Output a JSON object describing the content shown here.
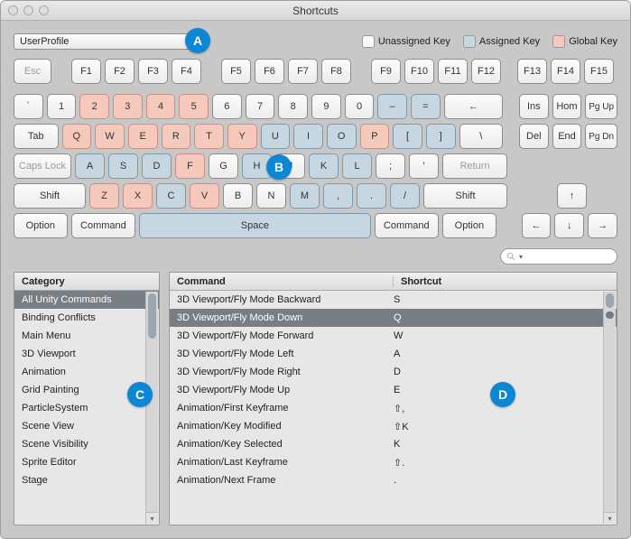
{
  "window": {
    "title": "Shortcuts"
  },
  "profile": {
    "label": "UserProfile"
  },
  "legend": {
    "unassigned": "Unassigned Key",
    "assigned": "Assigned Key",
    "global": "Global Key"
  },
  "badges": {
    "a": "A",
    "b": "B",
    "c": "C",
    "d": "D"
  },
  "keys": {
    "esc": "Esc",
    "f1": "F1",
    "f2": "F2",
    "f3": "F3",
    "f4": "F4",
    "f5": "F5",
    "f6": "F6",
    "f7": "F7",
    "f8": "F8",
    "f9": "F9",
    "f10": "F10",
    "f11": "F11",
    "f12": "F12",
    "f13": "F13",
    "f14": "F14",
    "f15": "F15",
    "backtick": "`",
    "n1": "1",
    "n2": "2",
    "n3": "3",
    "n4": "4",
    "n5": "5",
    "n6": "6",
    "n7": "7",
    "n8": "8",
    "n9": "9",
    "n0": "0",
    "minus": "–",
    "equals": "=",
    "back": "←",
    "tab": "Tab",
    "q": "Q",
    "w": "W",
    "e": "E",
    "r": "R",
    "t": "T",
    "y": "Y",
    "u": "U",
    "i": "I",
    "o": "O",
    "p": "P",
    "lbr": "[",
    "rbr": "]",
    "bslash": "\\",
    "caps": "Caps Lock",
    "a": "A",
    "s": "S",
    "d": "D",
    "f": "F",
    "g": "G",
    "h": "H",
    "j": "J",
    "k": "K",
    "l": "L",
    "semi": ";",
    "quote": "'",
    "return": "Return",
    "lshift": "Shift",
    "z": "Z",
    "x": "X",
    "c": "C",
    "v": "V",
    "b": "B",
    "n": "N",
    "m": "M",
    "comma": ",",
    "period": ".",
    "slash": "/",
    "rshift": "Shift",
    "loption": "Option",
    "lcmd": "Command",
    "space": "Space",
    "rcmd": "Command",
    "roption": "Option",
    "ins": "Ins",
    "home": "Hom",
    "pgup": "Pg Up",
    "del": "Del",
    "end": "End",
    "pgdn": "Pg Dn",
    "up": "↑",
    "left": "←",
    "down": "↓",
    "right": "→"
  },
  "headers": {
    "category": "Category",
    "command": "Command",
    "shortcut": "Shortcut"
  },
  "categories": [
    "All Unity Commands",
    "Binding Conflicts",
    "Main Menu",
    "3D Viewport",
    "Animation",
    "Grid Painting",
    "ParticleSystem",
    "Scene View",
    "Scene Visibility",
    "Sprite Editor",
    "Stage"
  ],
  "commands": [
    {
      "name": "3D Viewport/Fly Mode Backward",
      "shortcut": "S"
    },
    {
      "name": "3D Viewport/Fly Mode Down",
      "shortcut": "Q"
    },
    {
      "name": "3D Viewport/Fly Mode Forward",
      "shortcut": "W"
    },
    {
      "name": "3D Viewport/Fly Mode Left",
      "shortcut": "A"
    },
    {
      "name": "3D Viewport/Fly Mode Right",
      "shortcut": "D"
    },
    {
      "name": "3D Viewport/Fly Mode Up",
      "shortcut": "E"
    },
    {
      "name": "Animation/First Keyframe",
      "shortcut": "⇧,"
    },
    {
      "name": "Animation/Key Modified",
      "shortcut": "⇧K"
    },
    {
      "name": "Animation/Key Selected",
      "shortcut": "K"
    },
    {
      "name": "Animation/Last Keyframe",
      "shortcut": "⇧."
    },
    {
      "name": "Animation/Next Frame",
      "shortcut": "."
    }
  ],
  "selected_category_index": 0,
  "selected_command_index": 1
}
